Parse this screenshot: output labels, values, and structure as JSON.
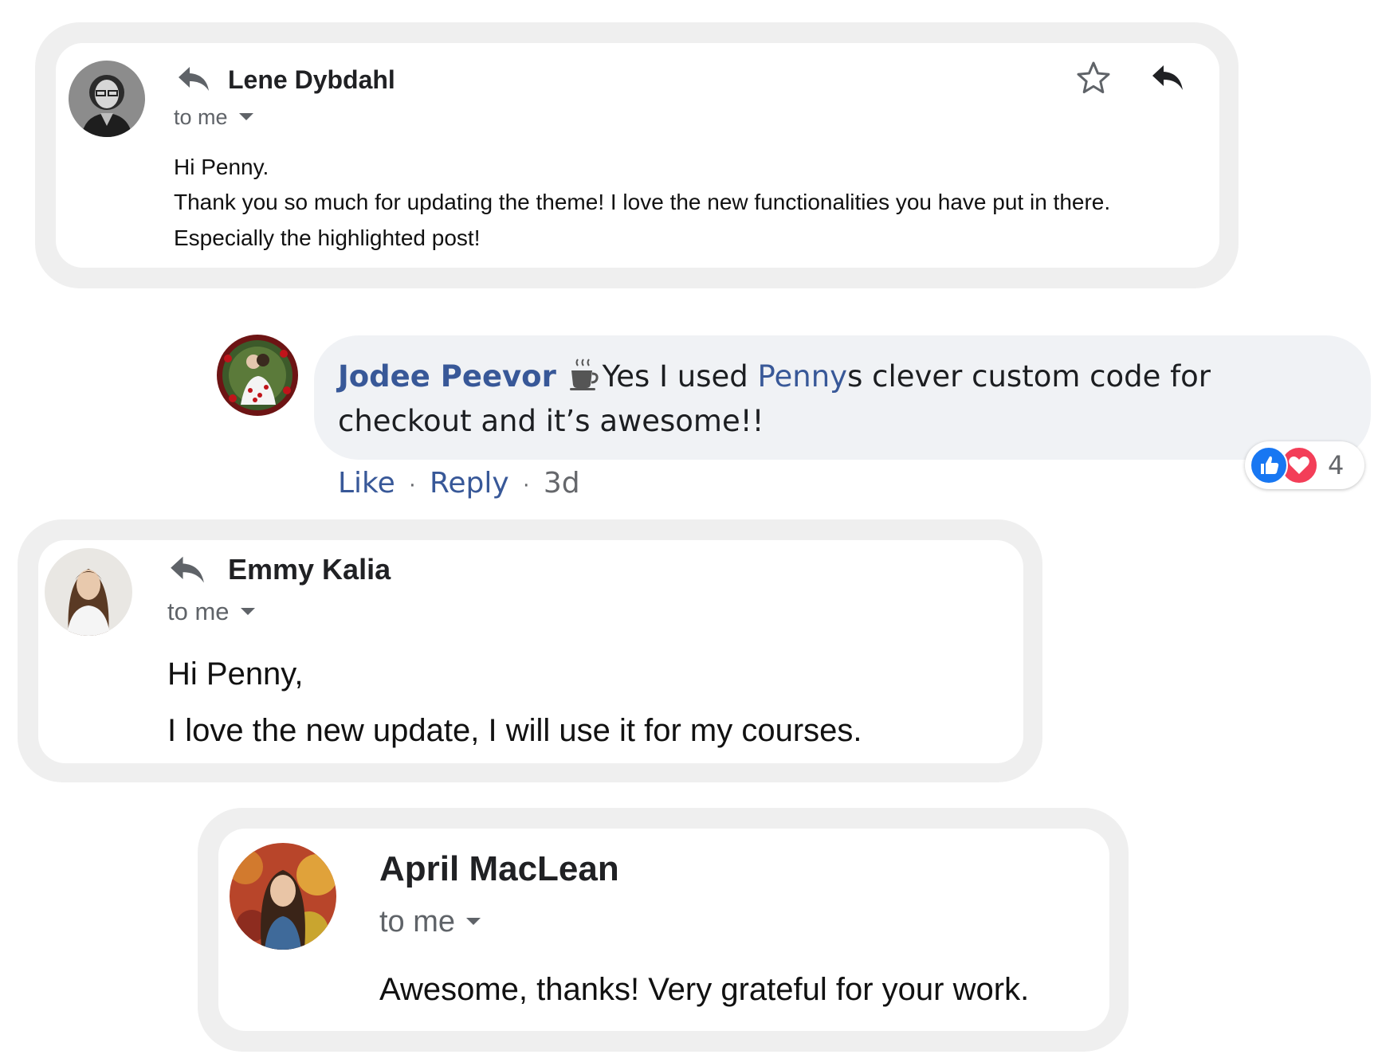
{
  "emails": [
    {
      "sender": "Lene Dybdahl",
      "recipient": "to me",
      "body": [
        "Hi Penny.",
        "Thank you so much for updating the theme! I love the new functionalities you have put in there.",
        "Especially the highlighted post!"
      ],
      "icons": [
        "reply-icon",
        "star-icon",
        "reply-icon"
      ]
    },
    {
      "sender": "Emmy Kalia",
      "recipient": "to me",
      "body": [
        "Hi Penny,",
        "I love the new update, I will use it for my courses."
      ],
      "icons": [
        "reply-icon"
      ]
    },
    {
      "sender": "April MacLean",
      "recipient": "to me",
      "body": [
        "Awesome, thanks! Very grateful for your work."
      ]
    }
  ],
  "comment": {
    "author": "Jodee Peevor",
    "author_badge_icon": "coffee-cup-icon",
    "text_part1": "Yes I used ",
    "mention": "Penny",
    "text_part2": "s clever custom code for",
    "text_line2": "checkout and it’s awesome!!",
    "like_label": "Like",
    "reply_label": "Reply",
    "separator": "·",
    "age": "3d",
    "reaction_icons": [
      "like-reaction-icon",
      "love-reaction-icon"
    ],
    "reaction_count": "4"
  },
  "colors": {
    "frame": "#efefef",
    "fb_bubble": "#f0f2f5",
    "fb_link": "#385898",
    "like_blue": "#1877f2",
    "love_red": "#f33e58"
  }
}
